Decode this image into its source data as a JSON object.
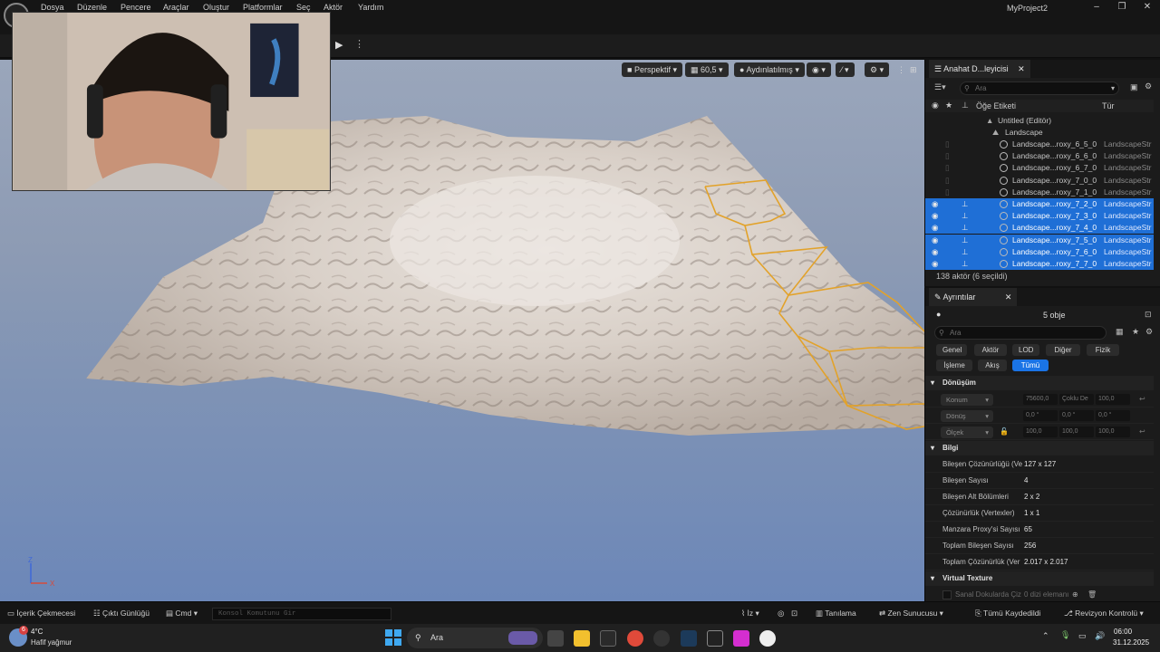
{
  "menu": {
    "items": [
      "Dosya",
      "Düzenle",
      "Pencere",
      "Araçlar",
      "Oluştur",
      "Platformlar",
      "Seç",
      "Aktör",
      "Yardım"
    ],
    "project_title": "MyProject2",
    "window_controls": [
      "minimize-icon",
      "restore-icon",
      "close-icon"
    ]
  },
  "viewport": {
    "perspective": "Perspektif",
    "fov": "60,5",
    "lighting": "Aydınlatılmış",
    "axis_x": "X",
    "axis_z": "Z"
  },
  "outliner": {
    "tab_title": "Anahat D...leyicisi",
    "search_placeholder": "Ara",
    "col_label": "Öğe Etiketi",
    "col_type": "Tür",
    "world": "Untitled (Editör)",
    "folder": "Landscape",
    "rows": [
      {
        "name": "Landscape...roxy_6_5_0",
        "type": "LandscapeStr",
        "selected": false
      },
      {
        "name": "Landscape...roxy_6_6_0",
        "type": "LandscapeStr",
        "selected": false
      },
      {
        "name": "Landscape...roxy_6_7_0",
        "type": "LandscapeStr",
        "selected": false
      },
      {
        "name": "Landscape...roxy_7_0_0",
        "type": "LandscapeStr",
        "selected": false
      },
      {
        "name": "Landscape...roxy_7_1_0",
        "type": "LandscapeStr",
        "selected": false
      },
      {
        "name": "Landscape...roxy_7_2_0",
        "type": "LandscapeStr",
        "selected": true
      },
      {
        "name": "Landscape...roxy_7_3_0",
        "type": "LandscapeStr",
        "selected": true
      },
      {
        "name": "Landscape...roxy_7_4_0",
        "type": "LandscapeStr",
        "selected": true
      },
      {
        "name": "Landscape...roxy_7_5_0",
        "type": "LandscapeStr",
        "selected": true
      },
      {
        "name": "Landscape...roxy_7_6_0",
        "type": "LandscapeStr",
        "selected": true
      },
      {
        "name": "Landscape...roxy_7_7_0",
        "type": "LandscapeStr",
        "selected": true
      }
    ],
    "footer": "138 aktör (6 seçildi)"
  },
  "details": {
    "tab_title": "Ayrıntılar",
    "object_count": "5 obje",
    "search_placeholder": "Ara",
    "filters_row1": [
      "Genel",
      "Aktör",
      "LOD",
      "Diğer",
      "Fizik"
    ],
    "filters_row2": [
      "İşleme",
      "Akış",
      "Tümü"
    ],
    "active_filter": "Tümü",
    "transform_section": "Dönüşüm",
    "transform_rows": [
      {
        "label": "Konum",
        "values": [
          "75600,0",
          "Çoklu De",
          "100,0"
        ]
      },
      {
        "label": "Dönüş",
        "values": [
          "0,0 °",
          "0,0 °",
          "0,0 °"
        ]
      },
      {
        "label": "Ölçek",
        "values": [
          "100,0",
          "100,0",
          "100,0"
        ]
      }
    ],
    "info_section": "Bilgi",
    "info_rows": [
      {
        "label": "Bileşen Çözünürlüğü (Ve",
        "value": "127 x 127"
      },
      {
        "label": "Bileşen Sayısı",
        "value": "4"
      },
      {
        "label": "Bileşen Alt Bölümleri",
        "value": "2 x 2"
      },
      {
        "label": "Çözünürlük (Vertexler)",
        "value": "1 x 1"
      },
      {
        "label": "Manzara Proxy'si Sayısı",
        "value": "65"
      },
      {
        "label": "Toplam Bileşen Sayısı",
        "value": "256"
      },
      {
        "label": "Toplam Çözünürlük (Ver",
        "value": "2.017 x 2.017"
      }
    ],
    "vt_section": "Virtual Texture",
    "vt_row_label": "Sanal Dokularda Çiz",
    "vt_row_value": "0 dizi elemanı"
  },
  "statusbar": {
    "content_drawer": "İçerik Çekmecesi",
    "output_log": "Çıktı Günlüğü",
    "cmd": "Cmd",
    "console_placeholder": "Konsol Komutunu Gir",
    "trace": "İz",
    "derived": "Tanılama",
    "zen": "Zen Sunucusu",
    "save_all": "Tümü Kaydedildi",
    "revision": "Revizyon Kontrolü"
  },
  "taskbar": {
    "weather_temp": "4°C",
    "weather_desc": "Hafif yağmur",
    "weather_badge": "6",
    "search": "Ara",
    "time": "06:00",
    "date": "31.12.2025"
  },
  "colors": {
    "selection": "#1f6fd6",
    "active_filter": "#1a74e6",
    "highlight_outline": "#e2a22a"
  }
}
